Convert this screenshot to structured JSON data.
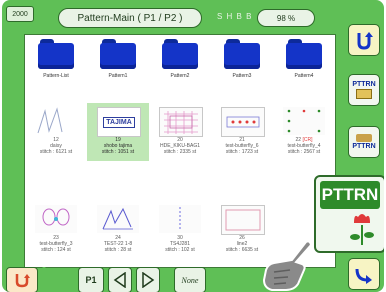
{
  "header": {
    "counter": "2000",
    "title": "Pattern-Main  ( P1 / P2 )",
    "status_dots": "S H B B",
    "percent": "98 %"
  },
  "folders": [
    {
      "label": "Pattern-List"
    },
    {
      "label": "Pattern1"
    },
    {
      "label": "Pattern2"
    },
    {
      "label": "Pattern3"
    },
    {
      "label": "Pattern4"
    }
  ],
  "patterns_row1": [
    {
      "number": "12",
      "name": "daisy",
      "stitch": "stitch : 6121 st"
    },
    {
      "number": "19",
      "name": "shobo tajima",
      "stitch": "stitch : 1051 st",
      "thumb_text": "TAJIMA"
    },
    {
      "number": "20",
      "name": "HDE_KIKU-BAG1",
      "stitch": "stitch : 2335 st"
    },
    {
      "number": "21",
      "name": "test-butterfly_6",
      "stitch": "stitch : 1723 st"
    },
    {
      "number": "22",
      "name": "test-butterfly_4",
      "stitch": "stitch : 2567 st",
      "tag": "[CR]"
    }
  ],
  "patterns_row2": [
    {
      "number": "23",
      "name": "test-butterfly_3",
      "stitch": "stitch : 124 st"
    },
    {
      "number": "24",
      "name": "TEST-22 1-8",
      "stitch": "stitch : 28 st"
    },
    {
      "number": "30",
      "name": "TS4J281",
      "stitch": "stitch : 102 st"
    },
    {
      "number": "26",
      "name": "line2",
      "stitch": "stitch : 6635 st"
    }
  ],
  "right_buttons": {
    "return_label": "U",
    "pttrn_edit_label": "PTTRN",
    "pttrn_sew_label": "PTTRN"
  },
  "bottom_bar": {
    "p1_label": "P1",
    "none_label": "None"
  },
  "popup": {
    "label": "PTTRN"
  },
  "colors": {
    "frame": "#5fbf56",
    "folder": "#1434c8",
    "selected": "#bfe7b5",
    "accent_red": "#e03a3a"
  }
}
